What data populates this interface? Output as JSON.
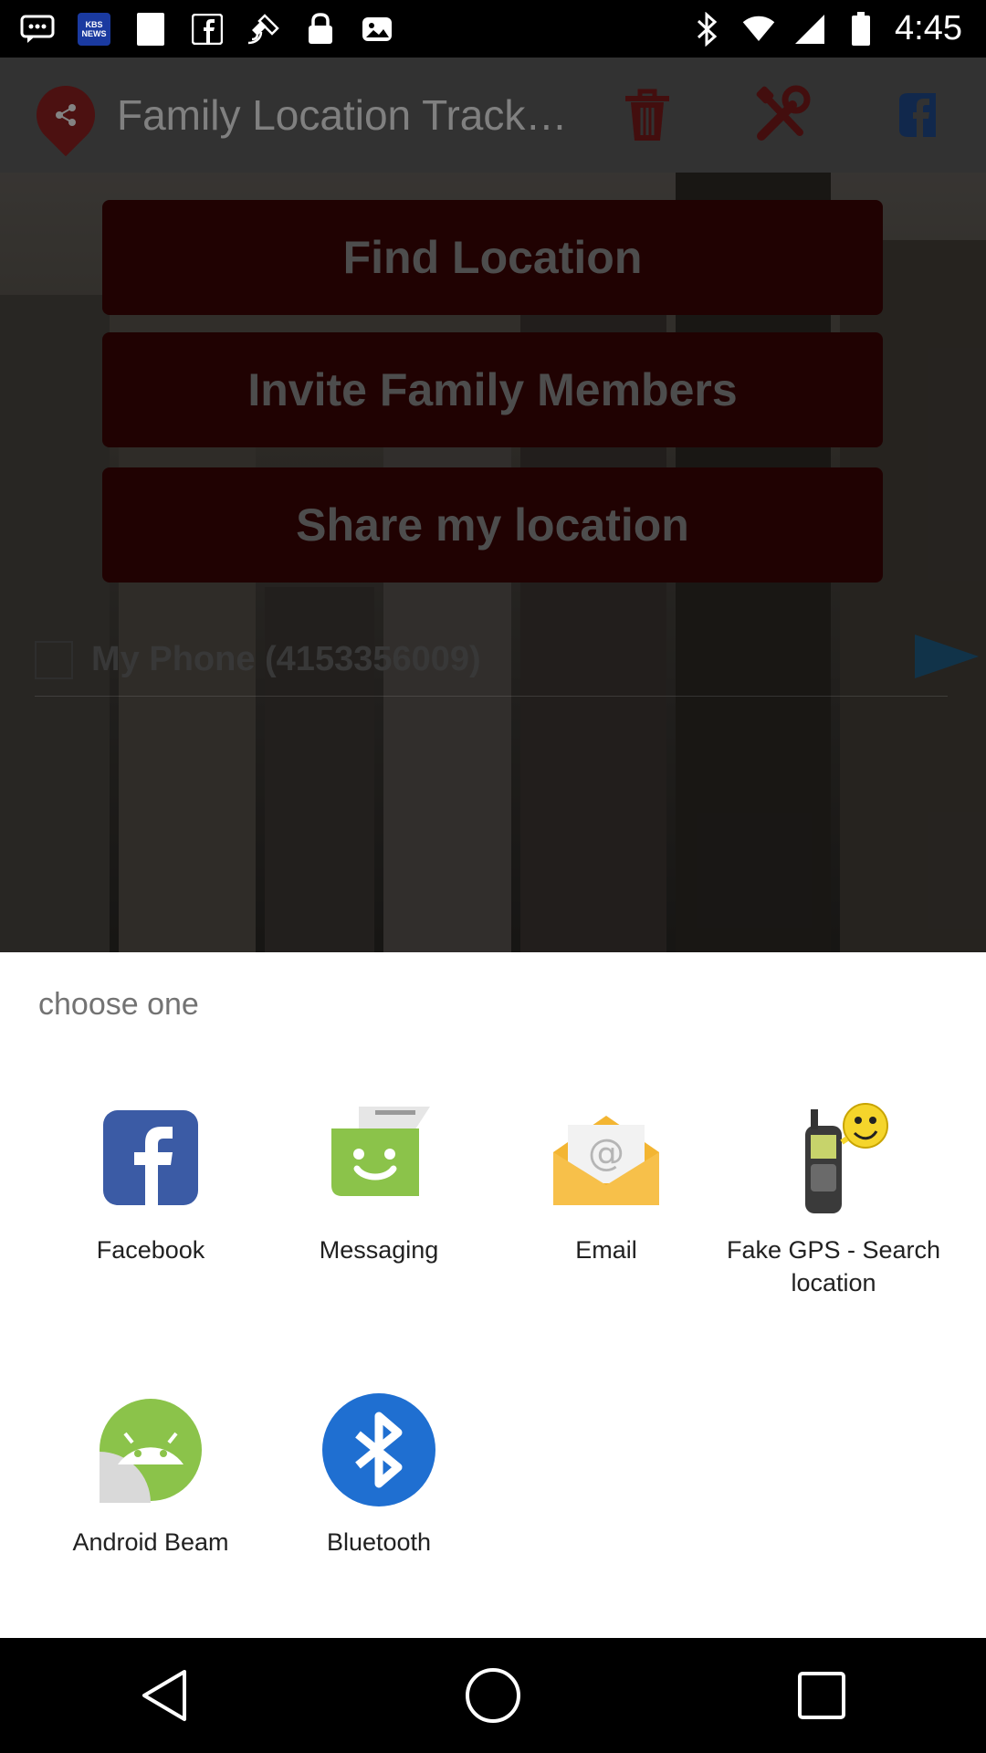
{
  "status_bar": {
    "time": "4:45",
    "icons": [
      "messages-icon",
      "kbs-news-icon",
      "square-icon",
      "facebook-icon",
      "fake-gps-icon",
      "lock-icon",
      "gallery-icon",
      "bluetooth-icon",
      "wifi-icon",
      "cell-signal-icon",
      "battery-icon"
    ],
    "news_badge": "KBS NEWS"
  },
  "app": {
    "title": "Family Location Track…",
    "buttons": {
      "find_location": "Find Location",
      "invite_family": "Invite Family Members",
      "share_location": "Share my location"
    },
    "phone_entry": "My Phone (4153356009)",
    "colors": {
      "button_bg": "#3b0404",
      "accent_arrow": "#1f5e86"
    }
  },
  "share_sheet": {
    "title": "choose one",
    "apps": [
      {
        "label": "Facebook",
        "icon": "facebook-icon"
      },
      {
        "label": "Messaging",
        "icon": "messaging-icon"
      },
      {
        "label": "Email",
        "icon": "email-icon"
      },
      {
        "label": "Fake GPS - Search location",
        "icon": "fake-gps-icon"
      },
      {
        "label": "Android Beam",
        "icon": "android-beam-icon"
      },
      {
        "label": "Bluetooth",
        "icon": "bluetooth-icon"
      }
    ]
  },
  "nav_bar": {
    "buttons": [
      "back-icon",
      "home-icon",
      "recents-icon"
    ]
  }
}
